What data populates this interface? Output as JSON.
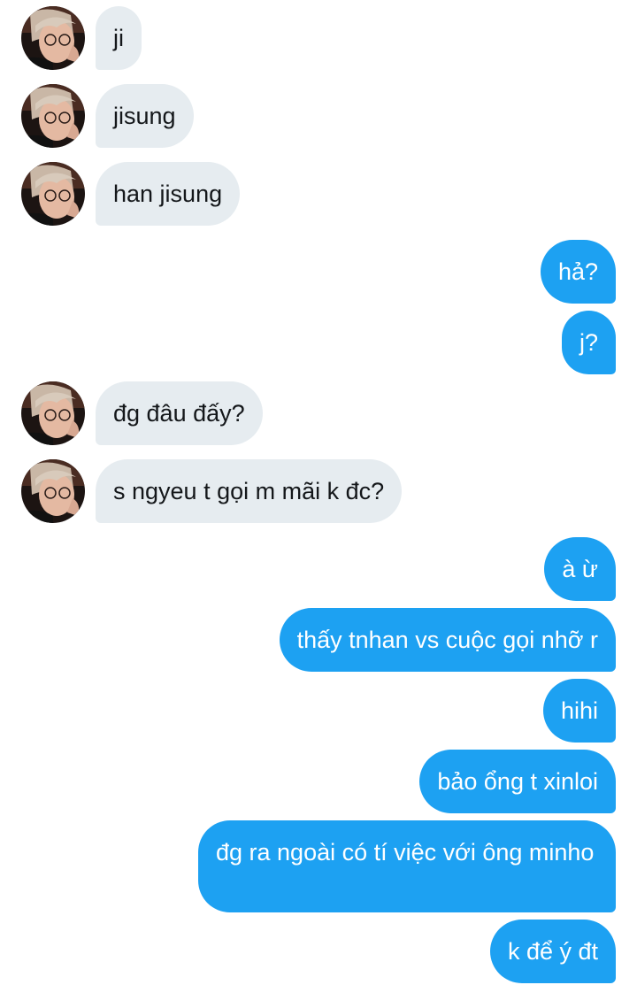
{
  "contact": {
    "avatar_icon": "user-avatar-photo"
  },
  "messages": [
    {
      "direction": "incoming",
      "text": "ji"
    },
    {
      "direction": "incoming",
      "text": "jisung"
    },
    {
      "direction": "incoming",
      "text": "han jisung"
    },
    {
      "direction": "outgoing",
      "text": "hả?"
    },
    {
      "direction": "outgoing",
      "text": "j?"
    },
    {
      "direction": "incoming",
      "text": "đg đâu đấy?"
    },
    {
      "direction": "incoming",
      "text": "s ngyeu t gọi m mãi k đc?"
    },
    {
      "direction": "outgoing",
      "text": "à ừ"
    },
    {
      "direction": "outgoing",
      "text": "thấy tnhan vs cuộc gọi nhỡ r"
    },
    {
      "direction": "outgoing",
      "text": "hihi"
    },
    {
      "direction": "outgoing",
      "text": "bảo ổng t xinloi"
    },
    {
      "direction": "outgoing",
      "text": "đg ra ngoài có tí việc với ông minho"
    },
    {
      "direction": "outgoing",
      "text": "k để ý đt"
    }
  ],
  "colors": {
    "incoming_bubble": "#e6ecf0",
    "outgoing_bubble": "#1da1f2",
    "incoming_text": "#14171a",
    "outgoing_text": "#ffffff"
  }
}
